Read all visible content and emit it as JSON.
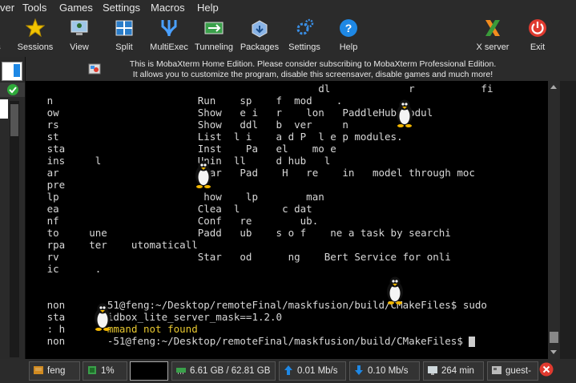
{
  "menu": [
    "ver",
    "Tools",
    "Games",
    "Settings",
    "Macros",
    "Help"
  ],
  "toolbar": [
    {
      "label": "ns",
      "icon": "partial-icon"
    },
    {
      "label": "Sessions",
      "icon": "star-icon"
    },
    {
      "label": "View",
      "icon": "monitor-icon"
    },
    {
      "label": "Split",
      "icon": "split-icon"
    },
    {
      "label": "MultiExec",
      "icon": "fork-icon"
    },
    {
      "label": "Tunneling",
      "icon": "tunnel-icon"
    },
    {
      "label": "Packages",
      "icon": "package-icon"
    },
    {
      "label": "Settings",
      "icon": "gears-icon"
    },
    {
      "label": "Help",
      "icon": "help-icon"
    },
    {
      "label": "X server",
      "icon": "x-server-icon"
    },
    {
      "label": "Exit",
      "icon": "power-icon"
    }
  ],
  "banner": {
    "line1": "This is MobaXterm Home Edition. Please consider subscribing to MobaXterm Professional Edition.",
    "line2": "It allows you to customize the program, disable this screensaver, disable games and much more!"
  },
  "terminal": {
    "lines": [
      "                                                dl             r           fi",
      "   n                        Run    sp    f  mod    .",
      "   ow                       Show   e i   r    lon   PaddleHub modul",
      "   rs                       Show   ddl   b  ver     n",
      "   st                       List  l i    a d P  l e p modules.",
      "   sta                      Inst    Pa   el    mo e",
      "   ins     l                Unin  ll     d hub   l",
      "   ar                       Sear   Pad    H   re    in   model through moc",
      "   pre",
      "   lp                        how    lp        man",
      "   ea                       Clea  l       c dat",
      "   nf                       Conf   re        ub.",
      "   to     une               Padd   ub    s o f    ne a task by searchi",
      "   rpa    ter    utomaticall",
      "   rv                       Star   od      ng    Bert Service for onli",
      "   ic      .",
      "",
      "   non       51@feng:~/Desktop/remoteFinal/maskfusion/build/CMakeFiles$ sudo",
      "   sta     amidbox_lite_server_mask==1.2.0",
      "   : h       mmand not found",
      "   non       -51@feng:~/Desktop/remoteFinal/maskfusion/build/CMakeFiles$ "
    ],
    "error_text": "mmand not found"
  },
  "status": [
    {
      "label": "feng",
      "icon": "user-icon"
    },
    {
      "label": "1%",
      "icon": "cpu-icon"
    },
    {
      "label": "",
      "icon": "blank-box"
    },
    {
      "label": "6.61 GB / 62.81 GB",
      "icon": "memory-icon"
    },
    {
      "label": "0.01 Mb/s",
      "icon": "upload-icon"
    },
    {
      "label": "0.10 Mb/s",
      "icon": "download-icon"
    },
    {
      "label": "264 min",
      "icon": "clock-icon"
    },
    {
      "label": "guest-",
      "icon": "guest-icon"
    }
  ],
  "colors": {
    "accent_yellow": "#e8c830",
    "error_red": "#e03a2f",
    "help_blue": "#1e88e5"
  }
}
